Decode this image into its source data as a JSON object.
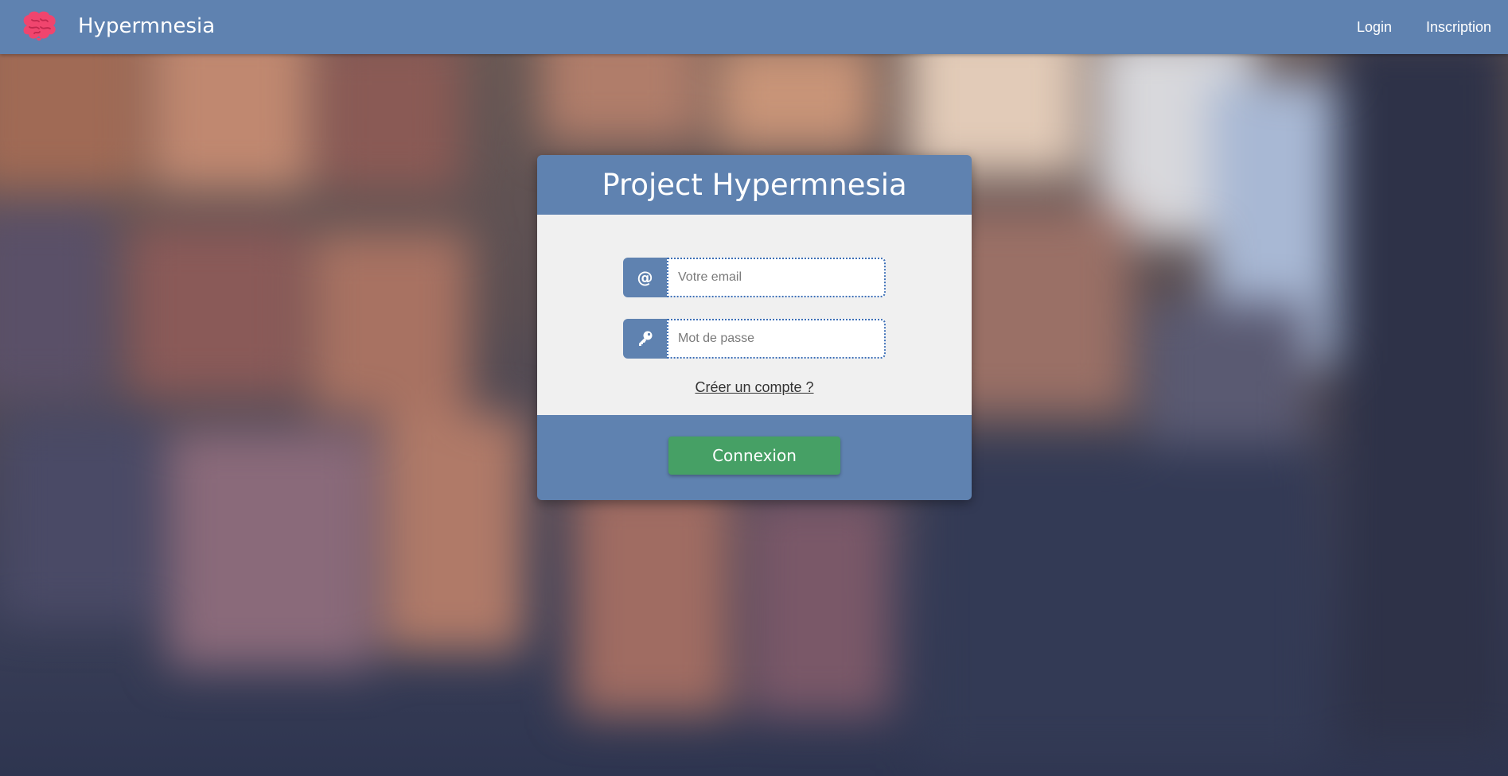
{
  "navbar": {
    "brand_name": "Hypermnesia",
    "brand_icon": "brain-icon",
    "links": [
      {
        "label": "Login"
      },
      {
        "label": "Inscription"
      }
    ]
  },
  "card": {
    "title": "Project Hypermnesia",
    "email": {
      "icon": "at-icon",
      "icon_glyph": "@",
      "placeholder": "Votre email",
      "value": ""
    },
    "password": {
      "icon": "key-icon",
      "placeholder": "Mot de passe",
      "value": ""
    },
    "create_account_label": "Créer un compte ?",
    "submit_label": "Connexion"
  },
  "colors": {
    "primary": "#5f82b0",
    "success": "#46a065",
    "card_body": "#f0f0f0",
    "brain": "#f0456e"
  }
}
